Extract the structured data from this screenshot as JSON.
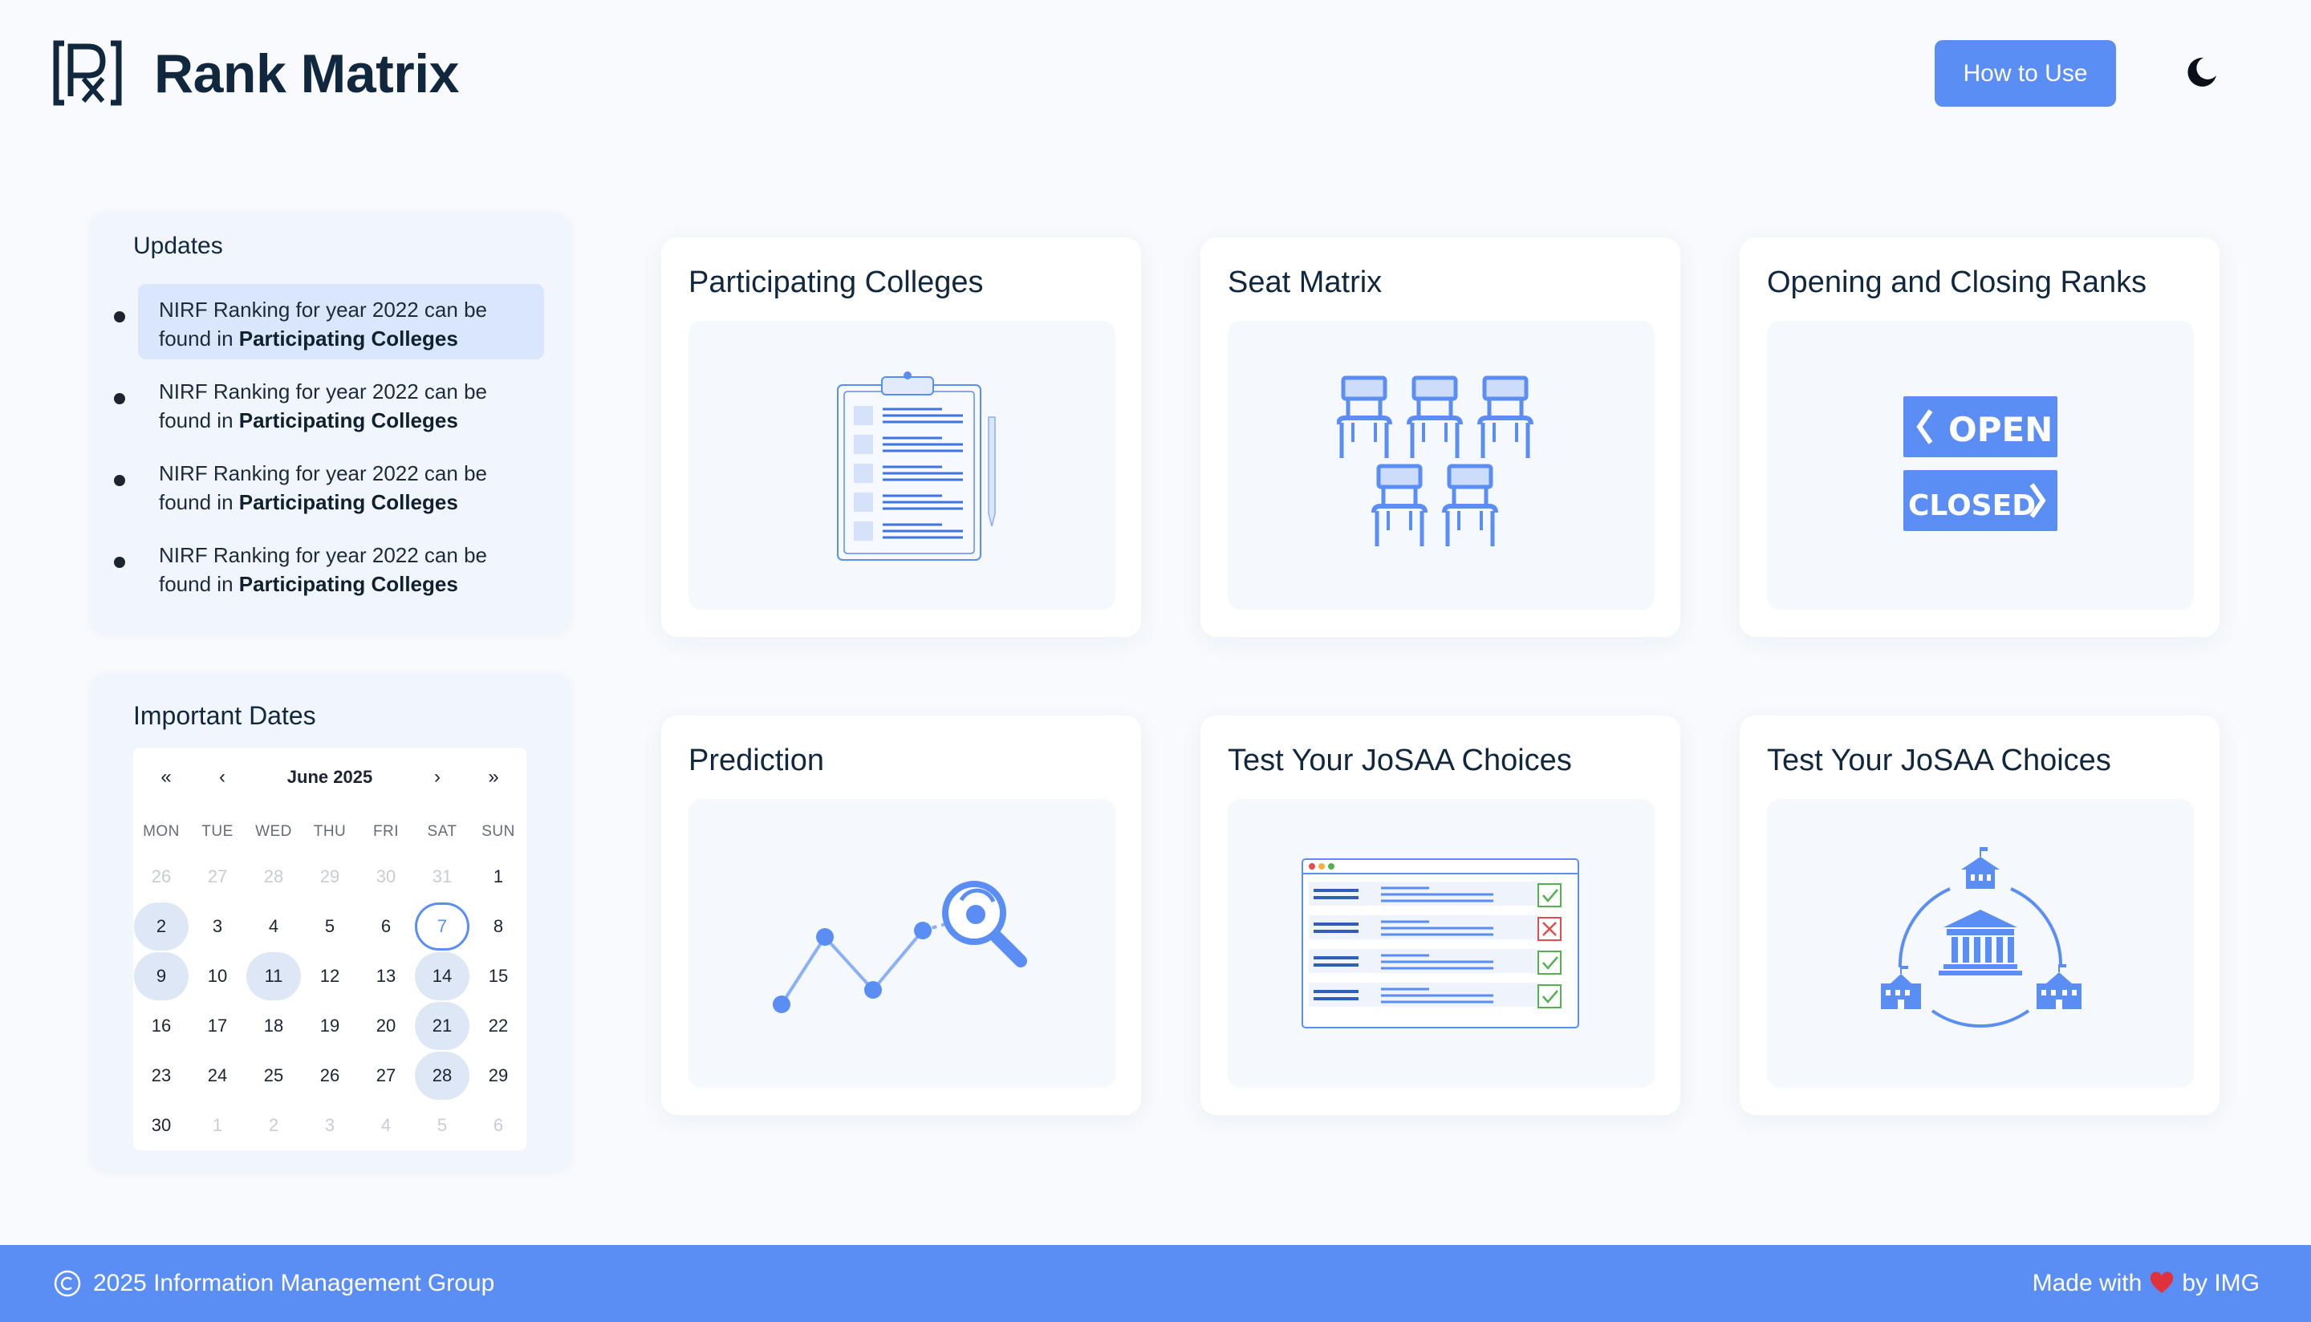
{
  "header": {
    "brand": "Rank Matrix",
    "how_to_use": "How to Use"
  },
  "updates": {
    "title": "Updates",
    "items": [
      {
        "text": "NIRF Ranking for year 2022 can be found in ",
        "link": "Participating Colleges"
      },
      {
        "text": "NIRF Ranking for year 2022 can be found in ",
        "link": "Participating Colleges"
      },
      {
        "text": "NIRF Ranking for year 2022 can be found in ",
        "link": "Participating Colleges"
      },
      {
        "text": "NIRF Ranking for year 2022 can be found in ",
        "link": "Participating Colleges"
      }
    ]
  },
  "dates": {
    "title": "Important Dates",
    "nav": {
      "first": "«",
      "prev": "‹",
      "month": "June 2025",
      "next": "›",
      "last": "»"
    },
    "weekdays": [
      "MON",
      "TUE",
      "WED",
      "THU",
      "FRI",
      "SAT",
      "SUN"
    ],
    "weeks": [
      [
        "26",
        "27",
        "28",
        "29",
        "30",
        "31",
        "1"
      ],
      [
        "2",
        "3",
        "4",
        "5",
        "6",
        "7",
        "8"
      ],
      [
        "9",
        "10",
        "11",
        "12",
        "13",
        "14",
        "15"
      ],
      [
        "16",
        "17",
        "18",
        "19",
        "20",
        "21",
        "22"
      ],
      [
        "23",
        "24",
        "25",
        "26",
        "27",
        "28",
        "29"
      ],
      [
        "30",
        "1",
        "2",
        "3",
        "4",
        "5",
        "6"
      ]
    ]
  },
  "cards": {
    "participating": "Participating Colleges",
    "seat_matrix": "Seat Matrix",
    "ranks": "Opening and Closing Ranks",
    "prediction": "Prediction",
    "test_choices": "Test Your JoSAA Choices",
    "test_choices_2": "Test Your JoSAA Choices"
  },
  "illustrations": {
    "open": "OPEN",
    "closed": "CLOSED"
  },
  "footer": {
    "copyright": "2025 Information Management Group",
    "made_with": "Made with",
    "by": "by IMG"
  },
  "colors": {
    "accent": "#5b8ef5",
    "text": "#10273d",
    "panel": "#f1f5fd"
  }
}
